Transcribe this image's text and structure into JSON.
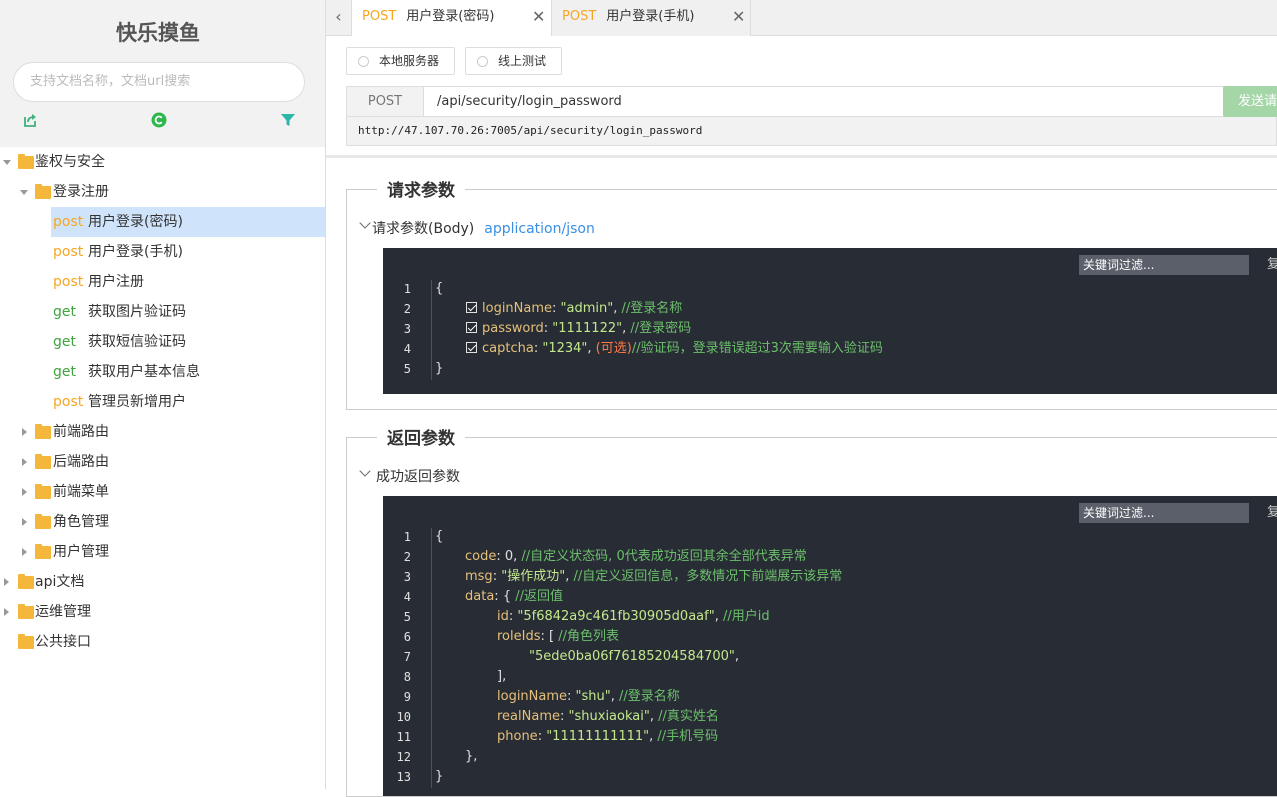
{
  "app": {
    "title": "快乐摸鱼"
  },
  "search": {
    "placeholder": "支持文档名称，文档url搜索"
  },
  "toolbar_icons": [
    "export-icon",
    "refresh-icon",
    "filter-icon"
  ],
  "tree": {
    "items": [
      {
        "label": "鉴权与安全",
        "type": "folder"
      },
      {
        "label": "登录注册",
        "type": "folder"
      },
      {
        "method": "post",
        "label": "用户登录(密码)"
      },
      {
        "method": "post",
        "label": "用户登录(手机)"
      },
      {
        "method": "post",
        "label": "用户注册"
      },
      {
        "method": "get",
        "label": "获取图片验证码"
      },
      {
        "method": "get",
        "label": "获取短信验证码"
      },
      {
        "method": "get",
        "label": "获取用户基本信息"
      },
      {
        "method": "post",
        "label": "管理员新增用户"
      },
      {
        "label": "前端路由",
        "type": "folder"
      },
      {
        "label": "后端路由",
        "type": "folder"
      },
      {
        "label": "前端菜单",
        "type": "folder"
      },
      {
        "label": "角色管理",
        "type": "folder"
      },
      {
        "label": "用户管理",
        "type": "folder"
      },
      {
        "label": "api文档",
        "type": "folder"
      },
      {
        "label": "运维管理",
        "type": "folder"
      },
      {
        "label": "公共接口",
        "type": "folder"
      }
    ]
  },
  "tabs": [
    {
      "method": "POST",
      "label": "用户登录(密码)",
      "close": "✕"
    },
    {
      "method": "POST",
      "label": "用户登录(手机)",
      "close": "✕"
    }
  ],
  "env": {
    "local": "本地服务器",
    "online": "线上测试"
  },
  "request": {
    "method": "POST",
    "path": "/api/security/login_password",
    "send_label": "发送请",
    "full_url": "http://47.107.70.26:7005/api/security/login_password"
  },
  "request_params": {
    "legend": "请求参数",
    "body_label": "请求参数(Body)",
    "content_type": "application/json",
    "filter_placeholder": "关键词过滤...",
    "copy_label": "复",
    "line_numbers": [
      "1",
      "2",
      "3",
      "4",
      "5"
    ],
    "open_brace": "{",
    "close_brace": "}",
    "fields": [
      {
        "key": "loginName",
        "value": "\"admin\"",
        "comment": "//登录名称"
      },
      {
        "key": "password",
        "value": "\"1111122\"",
        "comment": "//登录密码"
      },
      {
        "key": "captcha",
        "value": "\"1234\"",
        "optional": "(可选)",
        "comment": "//验证码，登录错误超过3次需要输入验证码"
      }
    ]
  },
  "response_params": {
    "legend": "返回参数",
    "success_label": "成功返回参数",
    "filter_placeholder": "关键词过滤...",
    "copy_label": "复",
    "line_numbers": [
      "1",
      "2",
      "3",
      "4",
      "5",
      "6",
      "7",
      "8",
      "9",
      "10",
      "11",
      "12",
      "13"
    ],
    "lines": {
      "l1": "{",
      "code_key": "code",
      "code_val": "0",
      "code_comment": "//自定义状态码, 0代表成功返回其余全部代表异常",
      "msg_key": "msg",
      "msg_val": "\"操作成功\"",
      "msg_comment": "//自定义返回信息，多数情况下前端展示该异常",
      "data_key": "data",
      "data_open": "{",
      "data_comment": "//返回值",
      "id_key": "id",
      "id_val": "\"5f6842a9c461fb30905d0aaf\"",
      "id_comment": "//用户id",
      "roleids_key": "roleIds",
      "roleids_open": "[",
      "roleids_comment": "//角色列表",
      "role_val": "\"5ede0ba06f76185204584700\"",
      "roleids_close": "],",
      "loginname_key": "loginName",
      "loginname_val": "\"shu\"",
      "loginname_comment": "//登录名称",
      "realname_key": "realName",
      "realname_val": "\"shuxiaokai\"",
      "realname_comment": "//真实姓名",
      "phone_key": "phone",
      "phone_val": "\"11111111111\"",
      "phone_comment": "//手机号码",
      "data_close": "},",
      "l13": "}"
    }
  }
}
